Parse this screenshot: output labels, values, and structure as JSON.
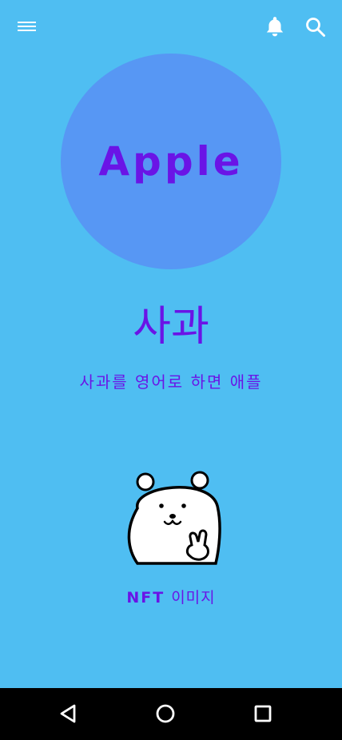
{
  "toolbar": {
    "menu_icon": "hamburger-menu-icon",
    "bell_icon": "bell-icon",
    "search_icon": "search-icon"
  },
  "hero": {
    "circle_label": "Apple",
    "circle_color": "#5797f4"
  },
  "content": {
    "title": "사과",
    "description": "사과를 영어로 하면 애플",
    "nft_caption_en": "NFT",
    "nft_caption_kr": "이미지",
    "nft_image_icon": "bear-character-icon"
  },
  "colors": {
    "background": "#4fbef2",
    "accent_text": "#6a14e6"
  },
  "system_nav": {
    "back_icon": "back-triangle-icon",
    "home_icon": "home-circle-icon",
    "recents_icon": "recents-square-icon"
  }
}
